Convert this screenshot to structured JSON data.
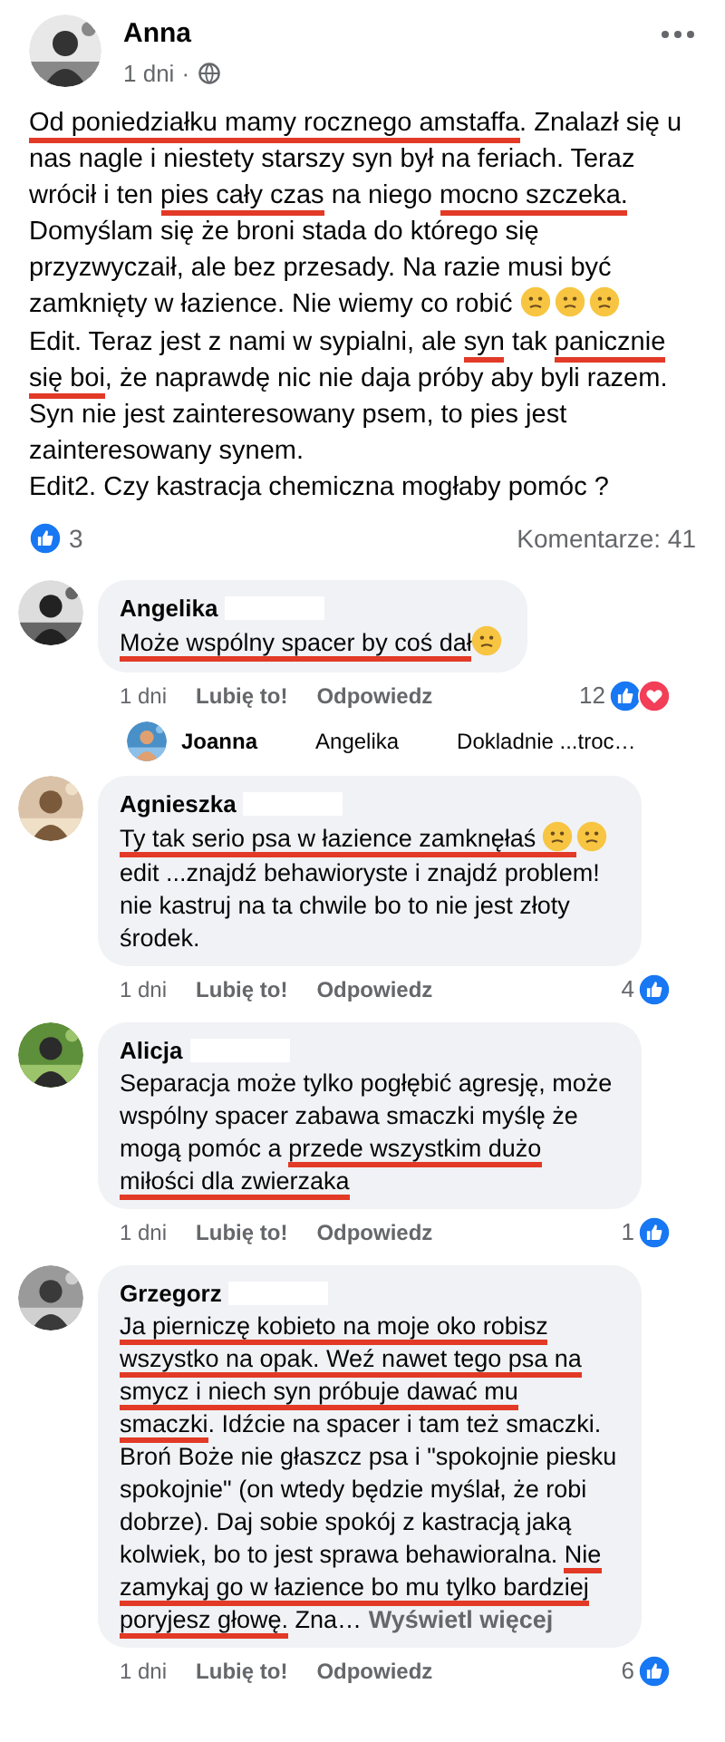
{
  "post": {
    "author": "Anna",
    "time": "1 dni",
    "separator": "·",
    "body": [
      {
        "kind": "text",
        "text": "Od poniedziałku mamy rocznego amstaffa",
        "underlined": true
      },
      {
        "kind": "text",
        "text": ". Znalazł się u nas nagle i niestety starszy syn był na feriach. Teraz wrócił i ten ",
        "underlined": false
      },
      {
        "kind": "text",
        "text": "pies cały czas",
        "underlined": true
      },
      {
        "kind": "text",
        "text": " na niego ",
        "underlined": false
      },
      {
        "kind": "text",
        "text": "mocno szczeka.",
        "underlined": true
      },
      {
        "kind": "text",
        "text": " Domyślam się że broni stada do którego się przyzwyczaił, ale bez przesady. Na razie musi być zamknięty w łazience. Nie wiemy co robić ",
        "underlined": false
      },
      {
        "kind": "emoji",
        "underlined": false
      },
      {
        "kind": "emoji",
        "underlined": false
      },
      {
        "kind": "emoji",
        "underlined": false
      },
      {
        "kind": "text",
        "text": "\nEdit. Teraz jest z nami w sypialni, ale ",
        "underlined": false
      },
      {
        "kind": "text",
        "text": "syn",
        "underlined": true
      },
      {
        "kind": "text",
        "text": " tak ",
        "underlined": false
      },
      {
        "kind": "text",
        "text": "panicznie się boi",
        "underlined": true
      },
      {
        "kind": "text",
        "text": ", że naprawdę nic nie daja próby aby byli razem. Syn nie jest zainteresowany psem, to pies jest zainteresowany synem.\nEdit2. Czy kastracja chemiczna mogłaby pomóc ?",
        "underlined": false
      }
    ],
    "likes": "3",
    "comments": "Komentarze: 41"
  },
  "comments": [
    {
      "author": "Angelika",
      "body": [
        {
          "kind": "text",
          "text": "Może wspólny spacer by coś dał",
          "underlined": true
        },
        {
          "kind": "emoji",
          "underlined": false
        }
      ],
      "time": "1 dni",
      "like": "Lubię to!",
      "reply": "Odpowiedz",
      "count": "12",
      "reactions": [
        {
          "kind": "like"
        },
        {
          "kind": "love"
        }
      ],
      "replies": [
        {
          "author": "Joanna",
          "mention": "Angelika",
          "preview": "Dokladnie ...troc…"
        }
      ]
    },
    {
      "author": "Agnieszka",
      "body": [
        {
          "kind": "text",
          "text": "Ty tak serio psa w łazience zamknęłaś ",
          "underlined": true
        },
        {
          "kind": "emoji",
          "underlined": true
        },
        {
          "kind": "emoji",
          "underlined": false
        },
        {
          "kind": "text",
          "text": " edit ...znajdź behawioryste i znajdź problem! nie kastruj na ta chwile bo to nie jest złoty środek.",
          "underlined": false
        }
      ],
      "time": "1 dni",
      "like": "Lubię to!",
      "reply": "Odpowiedz",
      "count": "4",
      "reactions": [
        {
          "kind": "like"
        }
      ]
    },
    {
      "author": "Alicja",
      "body": [
        {
          "kind": "text",
          "text": "Separacja może tylko pogłębić agresję, może wspólny spacer zabawa smaczki myślę że mogą pomóc a ",
          "underlined": false
        },
        {
          "kind": "text",
          "text": "przede wszystkim dużo miłości dla zwierzaka",
          "underlined": true
        }
      ],
      "time": "1 dni",
      "like": "Lubię to!",
      "reply": "Odpowiedz",
      "count": "1",
      "reactions": [
        {
          "kind": "like"
        }
      ]
    },
    {
      "author": "Grzegorz",
      "body": [
        {
          "kind": "text",
          "text": "Ja pierniczę kobieto na moje oko robisz wszystko na opak. Weź nawet tego psa na smycz i niech syn próbuje dawać mu smaczki",
          "underlined": true
        },
        {
          "kind": "text",
          "text": ". Idźcie na spacer i tam też smaczki. Broń Boże nie głaszcz psa i \"spokojnie piesku spokojnie\" (on wtedy będzie myślał, że robi dobrze). Daj sobie spokój z kastracją jaką kolwiek, bo to jest sprawa behawioralna. ",
          "underlined": false
        },
        {
          "kind": "text",
          "text": "Nie zamykaj go w łazience bo mu tylko bardziej poryjesz głowę.",
          "underlined": true
        },
        {
          "kind": "text",
          "text": " Zna…",
          "underlined": false
        }
      ],
      "more": "Wyświetl więcej",
      "time": "1 dni",
      "like": "Lubię to!",
      "reply": "Odpowiedz",
      "count": "6",
      "reactions": [
        {
          "kind": "like"
        }
      ]
    }
  ]
}
